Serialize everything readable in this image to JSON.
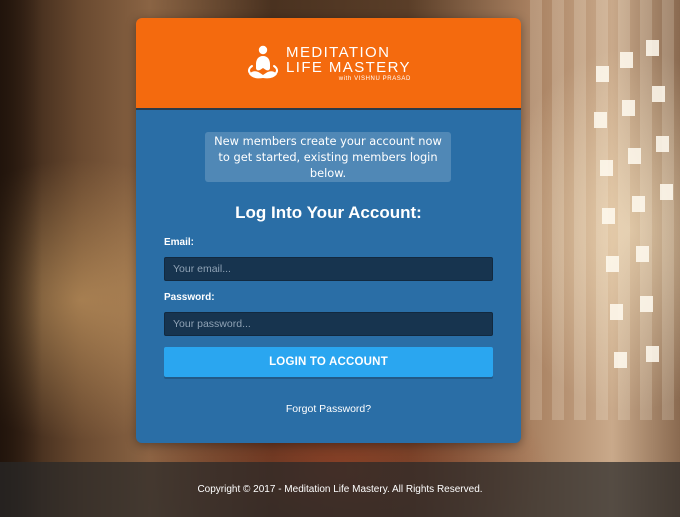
{
  "brand": {
    "line1": "MEDITATION",
    "line2": "LIFE MASTERY",
    "line3": "with VISHNU PRASAD",
    "colors": {
      "header": "#f46a0e",
      "panel": "#2a6ea6",
      "button": "#2aa6f0"
    },
    "icon": "meditating-figure-icon"
  },
  "notice": {
    "text": "New members create your account now to get started, existing members login below."
  },
  "form": {
    "title": "Log Into Your Account:",
    "email_label": "Email:",
    "email_placeholder": "Your email...",
    "password_label": "Password:",
    "password_placeholder": "Your password...",
    "submit_label": "LOGIN TO ACCOUNT",
    "forgot_label": "Forgot Password?"
  },
  "footer": {
    "copyright": "Copyright © 2017 - Meditation Life Mastery. All Rights Reserved."
  }
}
